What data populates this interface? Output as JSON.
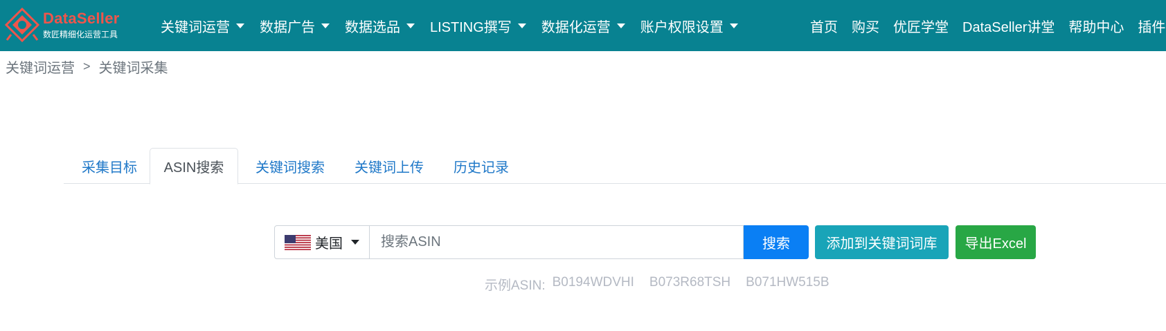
{
  "brand": {
    "name": "DataSeller",
    "slogan": "数匠精细化运营工具"
  },
  "nav": {
    "menus": [
      {
        "label": "关键词运营"
      },
      {
        "label": "数据广告"
      },
      {
        "label": "数据选品"
      },
      {
        "label": "LISTING撰写"
      },
      {
        "label": "数据化运营"
      },
      {
        "label": "账户权限设置"
      }
    ],
    "links": [
      {
        "label": "首页"
      },
      {
        "label": "购买"
      },
      {
        "label": "优匠学堂"
      },
      {
        "label": "DataSeller讲堂"
      },
      {
        "label": "帮助中心"
      },
      {
        "label": "插件"
      }
    ]
  },
  "breadcrumb": {
    "items": [
      "关键词运营",
      "关键词采集"
    ],
    "separator": ">"
  },
  "tabs": [
    {
      "label": "采集目标",
      "active": false
    },
    {
      "label": "ASIN搜索",
      "active": true
    },
    {
      "label": "关键词搜索",
      "active": false
    },
    {
      "label": "关键词上传",
      "active": false
    },
    {
      "label": "历史记录",
      "active": false
    }
  ],
  "search": {
    "country": "美国",
    "country_flag_icon": "us-flag-icon",
    "placeholder": "搜索ASIN",
    "value": "",
    "search_button": "搜索",
    "add_button": "添加到关键词词库",
    "export_button": "导出Excel"
  },
  "examples": {
    "label": "示例ASIN:",
    "asins": [
      "B0194WDVHI",
      "B073R68TSH",
      "B071HW515B"
    ]
  },
  "colors": {
    "navbar": "#088291",
    "brand_red": "#f0554b",
    "primary": "#0a7ff4",
    "info": "#19a4b8",
    "success": "#28a745",
    "link": "#1f78c8"
  }
}
